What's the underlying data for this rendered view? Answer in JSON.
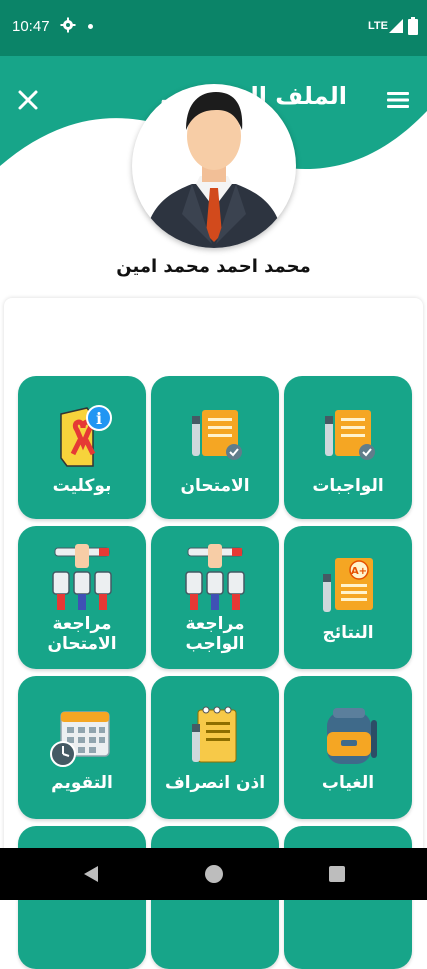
{
  "status_bar": {
    "time": "10:47",
    "network": "LTE"
  },
  "header": {
    "title": "الملف الشخصي"
  },
  "profile": {
    "name": "محمد احمد محمد امين"
  },
  "tiles": [
    {
      "label": "الواجبات",
      "icon": "homework-icon"
    },
    {
      "label": "الامتحان",
      "icon": "exam-icon"
    },
    {
      "label": "بوكليت",
      "icon": "booklet-icon"
    },
    {
      "label": "النتائج",
      "icon": "results-icon"
    },
    {
      "label": "مراجعة الواجب",
      "icon": "homework-review-icon"
    },
    {
      "label": "مراجعة الامتحان",
      "icon": "exam-review-icon"
    },
    {
      "label": "الغياب",
      "icon": "absence-icon"
    },
    {
      "label": "اذن انصراف",
      "icon": "leave-permission-icon"
    },
    {
      "label": "التقويم",
      "icon": "calendar-icon"
    }
  ],
  "colors": {
    "primary": "#17a589",
    "status_bar": "#0b8468"
  }
}
